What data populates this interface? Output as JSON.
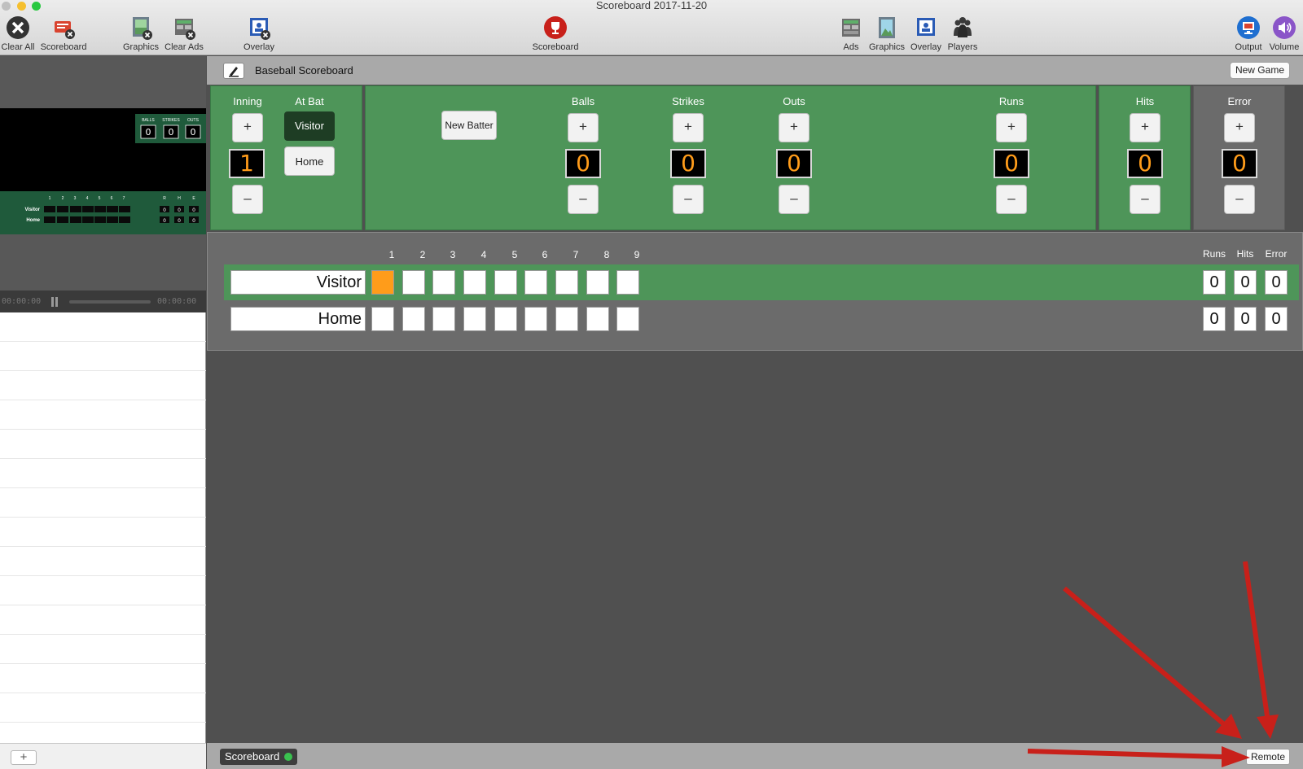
{
  "window": {
    "title": "Scoreboard 2017-11-20"
  },
  "toolbar": {
    "clear_all": "Clear All",
    "scoreboard_clear": "Scoreboard",
    "graphics_clear": "Graphics",
    "clear_ads": "Clear Ads",
    "overlay_clear": "Overlay",
    "scoreboard": "Scoreboard",
    "ads": "Ads",
    "graphics": "Graphics",
    "overlay": "Overlay",
    "players": "Players",
    "output": "Output",
    "volume": "Volume"
  },
  "preview": {
    "count_labels": [
      "BALLS",
      "STRIKES",
      "OUTS"
    ],
    "count_values": [
      "0",
      "0",
      "0"
    ],
    "innings": [
      "1",
      "2",
      "3",
      "4",
      "5",
      "6",
      "7"
    ],
    "rhe_labels": [
      "R",
      "H",
      "E"
    ],
    "teams": [
      {
        "name": "Visitor",
        "rhe": [
          "0",
          "0",
          "0"
        ]
      },
      {
        "name": "Home",
        "rhe": [
          "0",
          "0",
          "0"
        ]
      }
    ],
    "time_start": "00:00:00",
    "time_end": "00:00:00"
  },
  "header": {
    "title": "Baseball Scoreboard",
    "new_game": "New Game"
  },
  "controls": {
    "inning": {
      "label": "Inning",
      "value": "1"
    },
    "at_bat": {
      "label": "At Bat",
      "visitor": "Visitor",
      "home": "Home",
      "selected": "Visitor"
    },
    "new_batter": "New Batter",
    "balls": {
      "label": "Balls",
      "value": "0"
    },
    "strikes": {
      "label": "Strikes",
      "value": "0"
    },
    "outs": {
      "label": "Outs",
      "value": "0"
    },
    "runs": {
      "label": "Runs",
      "value": "0"
    },
    "hits": {
      "label": "Hits",
      "value": "0"
    },
    "error": {
      "label": "Error",
      "value": "0"
    },
    "plus": "+",
    "minus": "–"
  },
  "linescore": {
    "innings": [
      "1",
      "2",
      "3",
      "4",
      "5",
      "6",
      "7",
      "8",
      "9"
    ],
    "rhe_headers": [
      "Runs",
      "Hits",
      "Error"
    ],
    "teams": [
      {
        "name": "Visitor",
        "runs": "0",
        "hits": "0",
        "error": "0",
        "current_inning": 1
      },
      {
        "name": "Home",
        "runs": "0",
        "hits": "0",
        "error": "0"
      }
    ]
  },
  "left_bottom": {
    "add": "+"
  },
  "bottom": {
    "scoreboard_tag": "Scoreboard",
    "remote": "Remote"
  },
  "colors": {
    "accent_green": "#4e9559",
    "digit_orange": "#ff9c1a",
    "annotation_red": "#c8201a"
  }
}
